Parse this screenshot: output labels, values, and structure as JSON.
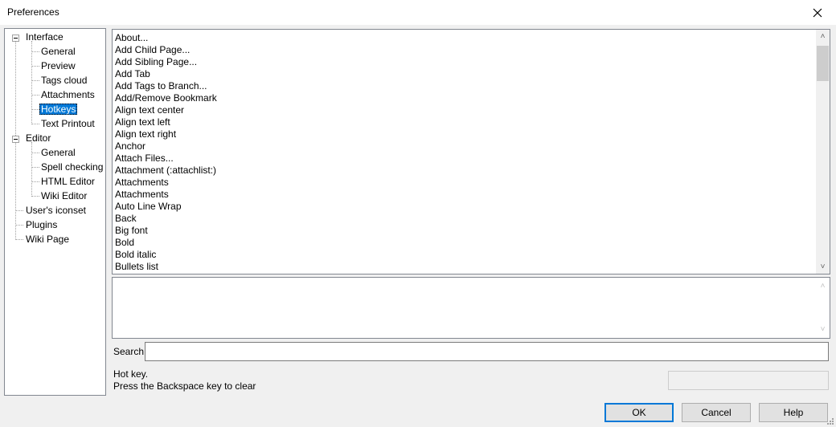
{
  "window": {
    "title": "Preferences",
    "close_glyph": "✕"
  },
  "tree": [
    {
      "label": "Interface",
      "selected": false,
      "expanded": true
    },
    {
      "label": "General",
      "selected": false
    },
    {
      "label": "Preview",
      "selected": false
    },
    {
      "label": "Tags cloud",
      "selected": false
    },
    {
      "label": "Attachments",
      "selected": false
    },
    {
      "label": "Hotkeys",
      "selected": true
    },
    {
      "label": "Text Printout",
      "selected": false
    },
    {
      "label": "Editor",
      "selected": false,
      "expanded": true
    },
    {
      "label": "General",
      "selected": false
    },
    {
      "label": "Spell checking",
      "selected": false
    },
    {
      "label": "HTML Editor",
      "selected": false
    },
    {
      "label": "Wiki Editor",
      "selected": false
    },
    {
      "label": "User's iconset",
      "selected": false
    },
    {
      "label": "Plugins",
      "selected": false
    },
    {
      "label": "Wiki Page",
      "selected": false
    }
  ],
  "commands": [
    "About...",
    "Add Child Page...",
    "Add Sibling Page...",
    "Add Tab",
    "Add Tags to Branch...",
    "Add/Remove Bookmark",
    "Align text center",
    "Align text left",
    "Align text right",
    "Anchor",
    "Attach Files...",
    "Attachment (:attachlist:)",
    "Attachments",
    "Attachments",
    "Auto Line Wrap",
    "Back",
    "Big font",
    "Bold",
    "Bold italic",
    "Bullets list"
  ],
  "search": {
    "label": "Search",
    "value": ""
  },
  "hint": {
    "line1": "Hot key.",
    "line2": "Press the Backspace key to clear"
  },
  "buttons": {
    "ok": "OK",
    "cancel": "Cancel",
    "help": "Help"
  },
  "scroll_arrows": {
    "up": "˄",
    "down": "˅"
  }
}
